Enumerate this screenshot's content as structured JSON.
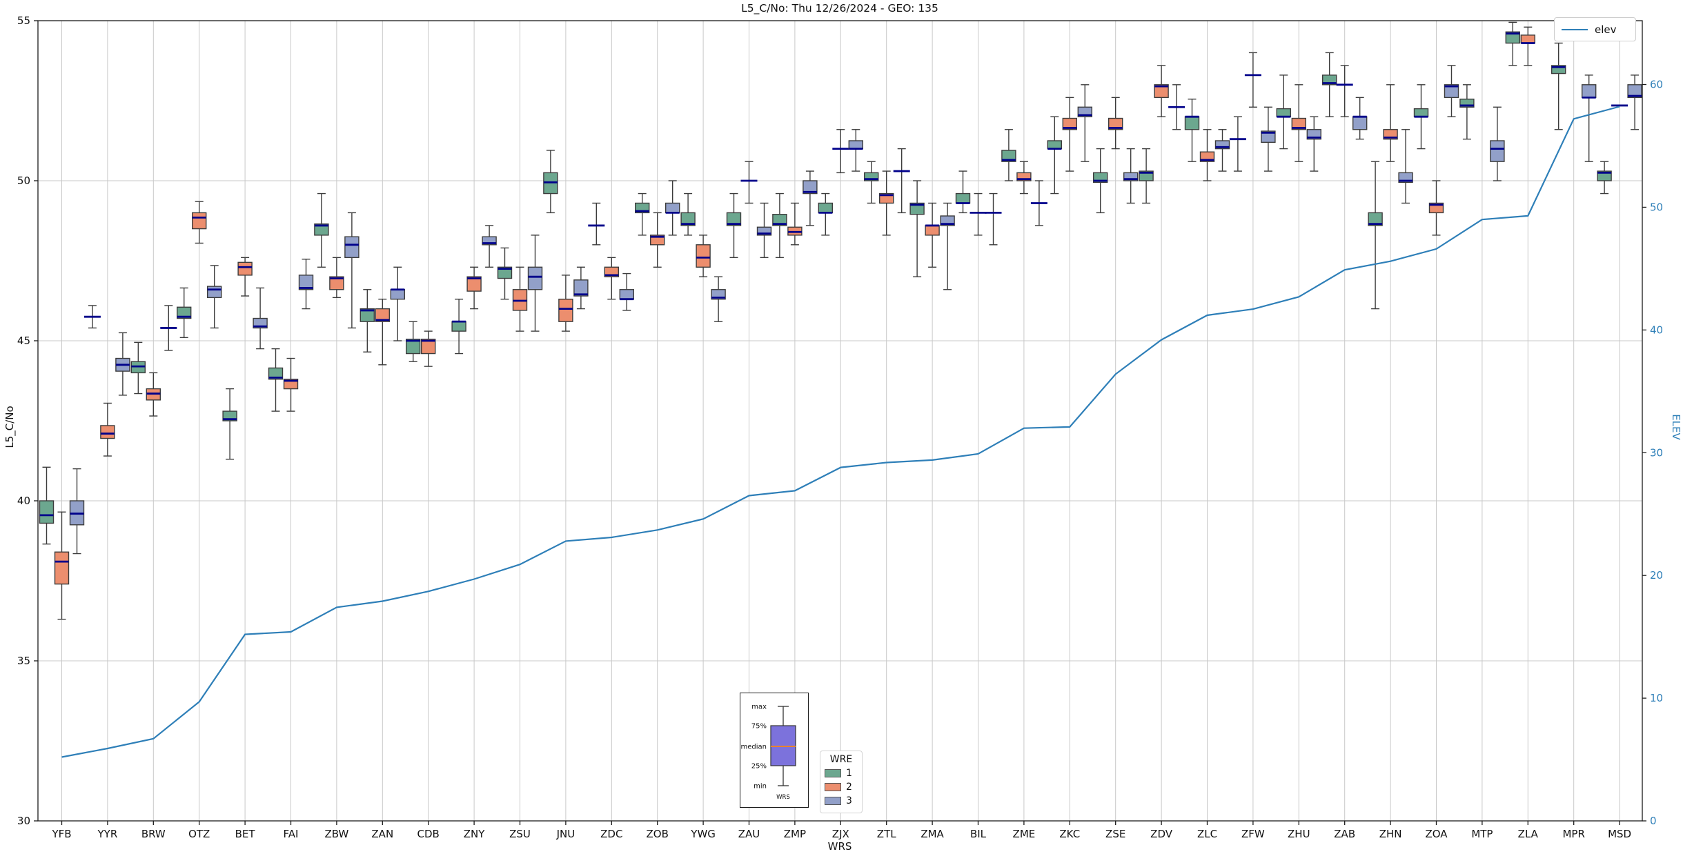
{
  "title": "L5_C/No: Thu 12/26/2024 - GEO: 135",
  "axes": {
    "left": {
      "label": "L5_C/No",
      "min": 30,
      "max": 55,
      "ticks": [
        30,
        35,
        40,
        45,
        50,
        55
      ]
    },
    "right": {
      "label": "ELEV",
      "min": 0,
      "max": 65.2,
      "ticks": [
        0,
        10,
        20,
        30,
        40,
        50,
        60
      ]
    },
    "x": {
      "label": "WRS"
    }
  },
  "legend_elev": {
    "label": "elev"
  },
  "wre_legend": {
    "title": "WRE",
    "entries": [
      {
        "label": "1",
        "color": "#6CA78F"
      },
      {
        "label": "2",
        "color": "#EC8E6E"
      },
      {
        "label": "3",
        "color": "#92A0C9"
      }
    ]
  },
  "inset": {
    "labels": [
      "max",
      "75%",
      "median",
      "25%",
      "min"
    ],
    "xlabel": "WRS",
    "box_color": "#7C72DC",
    "median_color": "#E8822D"
  },
  "colors": {
    "grid": "#C8C8C8",
    "spine": "#1a1a1a",
    "whisker": "#3c3c3c",
    "box_edge": "#3c3c3c",
    "median": "#00008B",
    "right_axis_text": "#2E7FB8",
    "tick_text": "#111111"
  },
  "chart_data": {
    "type": "box+line",
    "title": "L5_C/No: Thu 12/26/2024 - GEO: 135",
    "xlabel": "WRS",
    "ylabel_left": "L5_C/No",
    "ylabel_right": "ELEV",
    "ylim_left": [
      30,
      55
    ],
    "ylim_right": [
      0,
      65.2
    ],
    "grid": true,
    "categories": [
      "YFB",
      "YYR",
      "BRW",
      "OTZ",
      "BET",
      "FAI",
      "ZBW",
      "ZAN",
      "CDB",
      "ZNY",
      "ZSU",
      "JNU",
      "ZDC",
      "ZOB",
      "YWG",
      "ZAU",
      "ZMP",
      "ZJX",
      "ZTL",
      "ZMA",
      "BIL",
      "ZME",
      "ZKC",
      "ZSE",
      "ZDV",
      "ZLC",
      "ZFW",
      "ZHU",
      "ZAB",
      "ZHN",
      "ZOA",
      "MTP",
      "ZLA",
      "MPR",
      "MSD"
    ],
    "box_value_order": [
      "min",
      "q1",
      "median",
      "q3",
      "max"
    ],
    "series": [
      {
        "name": "1",
        "color": "#6CA78F",
        "boxes": [
          [
            38.65,
            39.3,
            39.55,
            40.0,
            41.05
          ],
          [
            45.4,
            45.75,
            45.75,
            45.75,
            46.1
          ],
          [
            43.35,
            44.0,
            44.2,
            44.35,
            44.95
          ],
          [
            45.1,
            45.7,
            45.75,
            46.05,
            46.65
          ],
          [
            41.3,
            42.5,
            42.55,
            42.8,
            43.5
          ],
          [
            42.8,
            43.8,
            43.85,
            44.15,
            44.75
          ],
          [
            47.3,
            48.3,
            48.6,
            48.65,
            49.6
          ],
          [
            44.65,
            45.6,
            45.95,
            46.0,
            46.6
          ],
          [
            44.35,
            44.6,
            45.0,
            45.05,
            45.6
          ],
          [
            44.6,
            45.3,
            45.6,
            45.6,
            46.3
          ],
          [
            46.3,
            46.95,
            47.25,
            47.3,
            47.9
          ],
          [
            49.0,
            49.6,
            49.95,
            50.25,
            50.95
          ],
          [
            48.0,
            48.6,
            48.6,
            48.6,
            49.3
          ],
          [
            48.3,
            49.0,
            49.05,
            49.3,
            49.6
          ],
          [
            48.3,
            48.6,
            48.65,
            49.0,
            49.6
          ],
          [
            47.6,
            48.6,
            48.65,
            49.0,
            49.6
          ],
          [
            47.6,
            48.6,
            48.65,
            48.95,
            49.6
          ],
          [
            48.3,
            49.0,
            49.0,
            49.3,
            49.6
          ],
          [
            49.3,
            50.0,
            50.05,
            50.25,
            50.6
          ],
          [
            47.0,
            48.95,
            49.25,
            49.3,
            50.0
          ],
          [
            49.0,
            49.3,
            49.3,
            49.6,
            50.3
          ],
          [
            50.0,
            50.6,
            50.65,
            50.95,
            51.6
          ],
          [
            49.6,
            51.0,
            51.0,
            51.25,
            52.0
          ],
          [
            49.0,
            49.95,
            50.0,
            50.25,
            51.0
          ],
          [
            49.3,
            50.0,
            50.25,
            50.3,
            51.0
          ],
          [
            50.6,
            51.6,
            52.0,
            52.0,
            52.55
          ],
          [
            50.3,
            51.3,
            51.3,
            51.3,
            52.0
          ],
          [
            51.0,
            52.0,
            52.0,
            52.25,
            53.3
          ],
          [
            52.0,
            53.0,
            53.05,
            53.3,
            54.0
          ],
          [
            46.0,
            48.6,
            48.65,
            49.0,
            50.6
          ],
          [
            51.0,
            52.0,
            52.0,
            52.25,
            53.0
          ],
          [
            51.3,
            52.3,
            52.35,
            52.55,
            53.0
          ],
          [
            53.6,
            54.3,
            54.6,
            54.65,
            54.95
          ],
          [
            51.6,
            53.35,
            53.55,
            53.6,
            54.3
          ],
          [
            49.6,
            50.0,
            50.25,
            50.3,
            50.6
          ]
        ]
      },
      {
        "name": "2",
        "color": "#EC8E6E",
        "boxes": [
          [
            36.3,
            37.4,
            38.1,
            38.4,
            39.65
          ],
          [
            41.4,
            41.95,
            42.1,
            42.35,
            43.05
          ],
          [
            42.65,
            43.15,
            43.35,
            43.5,
            44.0
          ],
          [
            48.05,
            48.5,
            48.85,
            49.0,
            49.35
          ],
          [
            46.4,
            47.05,
            47.3,
            47.45,
            47.6
          ],
          [
            42.8,
            43.5,
            43.75,
            43.8,
            44.45
          ],
          [
            46.35,
            46.6,
            46.95,
            47.0,
            47.6
          ],
          [
            44.25,
            45.6,
            45.65,
            46.0,
            46.3
          ],
          [
            44.2,
            44.6,
            45.0,
            45.05,
            45.3
          ],
          [
            46.0,
            46.55,
            46.95,
            47.0,
            47.3
          ],
          [
            45.3,
            45.95,
            46.25,
            46.6,
            47.3
          ],
          [
            45.3,
            45.6,
            46.0,
            46.3,
            47.05
          ],
          [
            46.3,
            47.0,
            47.05,
            47.3,
            47.6
          ],
          [
            47.3,
            48.0,
            48.25,
            48.3,
            49.0
          ],
          [
            47.0,
            47.3,
            47.6,
            48.0,
            48.3
          ],
          [
            49.3,
            50.0,
            50.0,
            50.0,
            50.6
          ],
          [
            48.0,
            48.3,
            48.4,
            48.55,
            49.3
          ],
          [
            50.25,
            51.0,
            51.0,
            51.0,
            51.6
          ],
          [
            48.3,
            49.3,
            49.55,
            49.6,
            50.3
          ],
          [
            47.3,
            48.3,
            48.6,
            48.6,
            49.3
          ],
          [
            48.3,
            49.0,
            49.0,
            49.0,
            49.6
          ],
          [
            49.6,
            50.0,
            50.05,
            50.25,
            50.6
          ],
          [
            50.3,
            51.6,
            51.65,
            51.95,
            52.6
          ],
          [
            51.0,
            51.6,
            51.65,
            51.95,
            52.6
          ],
          [
            52.0,
            52.6,
            52.95,
            53.0,
            53.6
          ],
          [
            50.0,
            50.6,
            50.65,
            50.9,
            51.6
          ],
          [
            52.3,
            53.3,
            53.3,
            53.3,
            54.0
          ],
          [
            50.6,
            51.6,
            51.65,
            51.95,
            53.0
          ],
          [
            52.0,
            53.0,
            53.0,
            53.0,
            53.6
          ],
          [
            50.6,
            51.3,
            51.35,
            51.6,
            53.0
          ],
          [
            48.3,
            49.0,
            49.25,
            49.3,
            50.0
          ],
          null,
          [
            53.6,
            54.3,
            54.3,
            54.55,
            54.8
          ],
          null,
          [
            52.35,
            52.35,
            52.35,
            52.35,
            52.35
          ]
        ]
      },
      {
        "name": "3",
        "color": "#92A0C9",
        "boxes": [
          [
            38.35,
            39.25,
            39.6,
            40.0,
            41.0
          ],
          [
            43.3,
            44.05,
            44.25,
            44.45,
            45.25
          ],
          [
            44.7,
            45.4,
            45.4,
            45.4,
            46.1
          ],
          [
            45.4,
            46.35,
            46.6,
            46.7,
            47.35
          ],
          [
            44.75,
            45.4,
            45.45,
            45.7,
            46.65
          ],
          [
            46.0,
            46.6,
            46.65,
            47.05,
            47.55
          ],
          [
            45.4,
            47.6,
            48.0,
            48.25,
            49.0
          ],
          [
            45.0,
            46.3,
            46.6,
            46.6,
            47.3
          ],
          null,
          [
            47.3,
            48.0,
            48.05,
            48.25,
            48.6
          ],
          [
            45.3,
            46.6,
            47.0,
            47.3,
            48.3
          ],
          [
            46.0,
            46.4,
            46.45,
            46.9,
            47.3
          ],
          [
            45.95,
            46.3,
            46.3,
            46.6,
            47.1
          ],
          [
            48.3,
            49.0,
            49.0,
            49.3,
            50.0
          ],
          [
            45.6,
            46.3,
            46.35,
            46.6,
            47.0
          ],
          [
            47.6,
            48.3,
            48.35,
            48.55,
            49.3
          ],
          [
            48.6,
            49.6,
            49.65,
            50.0,
            50.3
          ],
          [
            50.3,
            51.0,
            51.0,
            51.25,
            51.6
          ],
          [
            49.0,
            50.3,
            50.3,
            50.3,
            51.0
          ],
          [
            46.6,
            48.6,
            48.65,
            48.9,
            49.3
          ],
          [
            48.0,
            49.0,
            49.0,
            49.0,
            49.6
          ],
          [
            48.6,
            49.3,
            49.3,
            49.3,
            50.0
          ],
          [
            50.6,
            52.0,
            52.05,
            52.3,
            53.0
          ],
          [
            49.3,
            50.0,
            50.05,
            50.25,
            51.0
          ],
          [
            51.6,
            52.3,
            52.3,
            52.3,
            53.0
          ],
          [
            50.3,
            51.0,
            51.05,
            51.25,
            51.6
          ],
          [
            50.3,
            51.2,
            51.5,
            51.55,
            52.3
          ],
          [
            50.3,
            51.3,
            51.35,
            51.6,
            52.0
          ],
          [
            51.3,
            51.6,
            52.0,
            52.0,
            52.6
          ],
          [
            49.3,
            49.95,
            50.0,
            50.25,
            51.6
          ],
          [
            52.0,
            52.6,
            52.95,
            53.0,
            53.6
          ],
          [
            50.0,
            50.6,
            51.0,
            51.25,
            52.3
          ],
          null,
          [
            50.6,
            52.6,
            52.6,
            53.0,
            53.3
          ],
          [
            51.6,
            52.6,
            52.65,
            53.0,
            53.3
          ]
        ]
      }
    ],
    "line": {
      "name": "elev",
      "color": "#2E7FB8",
      "axis": "right",
      "values": [
        5.2,
        5.9,
        6.7,
        9.7,
        15.2,
        15.4,
        17.4,
        17.9,
        18.7,
        19.7,
        20.9,
        22.8,
        23.1,
        23.7,
        24.6,
        26.5,
        26.9,
        28.8,
        29.2,
        29.4,
        29.9,
        32.0,
        32.1,
        36.4,
        39.2,
        41.2,
        41.7,
        42.7,
        44.9,
        45.6,
        46.6,
        49.0,
        49.3,
        57.2,
        58.2
      ],
      "legend_position": "upper right"
    }
  }
}
